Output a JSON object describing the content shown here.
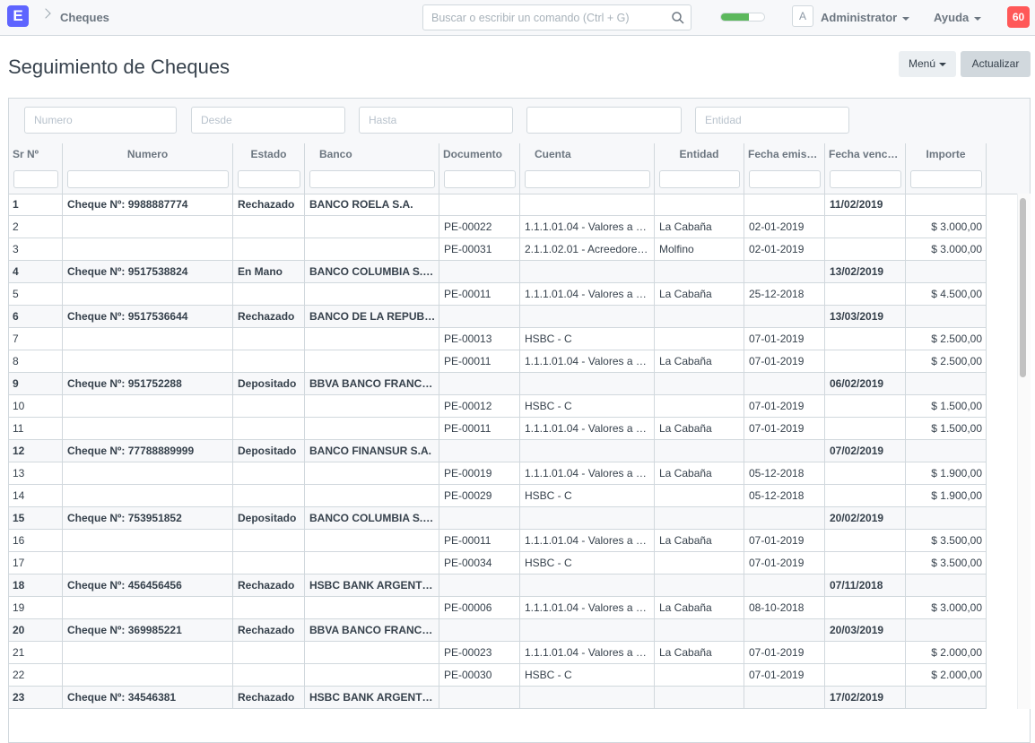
{
  "navbar": {
    "logo": "E",
    "breadcrumb": "Cheques",
    "search_placeholder": "Buscar o escribir un comando (Ctrl + G)",
    "progress_percent": 65,
    "avatar_letter": "A",
    "user_label": "Administrator",
    "help_label": "Ayuda",
    "notifications": "60"
  },
  "page": {
    "title": "Seguimiento de Cheques",
    "menu_label": "Menú",
    "refresh_label": "Actualizar"
  },
  "filters": {
    "numero": "Numero",
    "desde": "Desde",
    "hasta": "Hasta",
    "blank": "",
    "entidad": "Entidad"
  },
  "columns": [
    "Sr Nº",
    "Numero",
    "Estado",
    "Banco",
    "Documento",
    "Cuenta",
    "Entidad",
    "Fecha emis…",
    "Fecha venc…",
    "Importe"
  ],
  "rows": [
    {
      "sr": "1",
      "numero": "Cheque Nº: 9988887774",
      "estado": "Rechazado",
      "banco": "BANCO ROELA S.A.",
      "documento": "",
      "cuenta": "",
      "entidad": "",
      "emision": "",
      "venc": "11/02/2019",
      "importe": "",
      "parent": true
    },
    {
      "sr": "2",
      "numero": "",
      "estado": "",
      "banco": "",
      "documento": "PE-00022",
      "cuenta": "1.1.1.01.04 - Valores a …",
      "entidad": "La Cabaña",
      "emision": "02-01-2019",
      "venc": "",
      "importe": "$ 3.000,00",
      "parent": false
    },
    {
      "sr": "3",
      "numero": "",
      "estado": "",
      "banco": "",
      "documento": "PE-00031",
      "cuenta": "2.1.1.02.01 - Acreedore…",
      "entidad": "Molfino",
      "emision": "02-01-2019",
      "venc": "",
      "importe": "$ 3.000,00",
      "parent": false
    },
    {
      "sr": "4",
      "numero": "Cheque Nº: 9517538824",
      "estado": "En Mano",
      "banco": "BANCO COLUMBIA S.…",
      "documento": "",
      "cuenta": "",
      "entidad": "",
      "emision": "",
      "venc": "13/02/2019",
      "importe": "",
      "parent": true
    },
    {
      "sr": "5",
      "numero": "",
      "estado": "",
      "banco": "",
      "documento": "PE-00011",
      "cuenta": "1.1.1.01.04 - Valores a …",
      "entidad": "La Cabaña",
      "emision": "25-12-2018",
      "venc": "",
      "importe": "$ 4.500,00",
      "parent": false
    },
    {
      "sr": "6",
      "numero": "Cheque Nº: 9517536644",
      "estado": "Rechazado",
      "banco": "BANCO DE LA REPUB…",
      "documento": "",
      "cuenta": "",
      "entidad": "",
      "emision": "",
      "venc": "13/03/2019",
      "importe": "",
      "parent": true
    },
    {
      "sr": "7",
      "numero": "",
      "estado": "",
      "banco": "",
      "documento": "PE-00013",
      "cuenta": "HSBC - C",
      "entidad": "",
      "emision": "07-01-2019",
      "venc": "",
      "importe": "$ 2.500,00",
      "parent": false
    },
    {
      "sr": "8",
      "numero": "",
      "estado": "",
      "banco": "",
      "documento": "PE-00011",
      "cuenta": "1.1.1.01.04 - Valores a …",
      "entidad": "La Cabaña",
      "emision": "07-01-2019",
      "venc": "",
      "importe": "$ 2.500,00",
      "parent": false
    },
    {
      "sr": "9",
      "numero": "Cheque Nº: 951752288",
      "estado": "Depositado",
      "banco": "BBVA BANCO FRANC…",
      "documento": "",
      "cuenta": "",
      "entidad": "",
      "emision": "",
      "venc": "06/02/2019",
      "importe": "",
      "parent": true
    },
    {
      "sr": "10",
      "numero": "",
      "estado": "",
      "banco": "",
      "documento": "PE-00012",
      "cuenta": "HSBC - C",
      "entidad": "",
      "emision": "07-01-2019",
      "venc": "",
      "importe": "$ 1.500,00",
      "parent": false
    },
    {
      "sr": "11",
      "numero": "",
      "estado": "",
      "banco": "",
      "documento": "PE-00011",
      "cuenta": "1.1.1.01.04 - Valores a …",
      "entidad": "La Cabaña",
      "emision": "07-01-2019",
      "venc": "",
      "importe": "$ 1.500,00",
      "parent": false
    },
    {
      "sr": "12",
      "numero": "Cheque Nº: 77788889999",
      "estado": "Depositado",
      "banco": "BANCO FINANSUR S.A.",
      "documento": "",
      "cuenta": "",
      "entidad": "",
      "emision": "",
      "venc": "07/02/2019",
      "importe": "",
      "parent": true
    },
    {
      "sr": "13",
      "numero": "",
      "estado": "",
      "banco": "",
      "documento": "PE-00019",
      "cuenta": "1.1.1.01.04 - Valores a …",
      "entidad": "La Cabaña",
      "emision": "05-12-2018",
      "venc": "",
      "importe": "$ 1.900,00",
      "parent": false
    },
    {
      "sr": "14",
      "numero": "",
      "estado": "",
      "banco": "",
      "documento": "PE-00029",
      "cuenta": "HSBC - C",
      "entidad": "",
      "emision": "05-12-2018",
      "venc": "",
      "importe": "$ 1.900,00",
      "parent": false
    },
    {
      "sr": "15",
      "numero": "Cheque Nº: 753951852",
      "estado": "Depositado",
      "banco": "BANCO COLUMBIA S.…",
      "documento": "",
      "cuenta": "",
      "entidad": "",
      "emision": "",
      "venc": "20/02/2019",
      "importe": "",
      "parent": true
    },
    {
      "sr": "16",
      "numero": "",
      "estado": "",
      "banco": "",
      "documento": "PE-00011",
      "cuenta": "1.1.1.01.04 - Valores a …",
      "entidad": "La Cabaña",
      "emision": "07-01-2019",
      "venc": "",
      "importe": "$ 3.500,00",
      "parent": false
    },
    {
      "sr": "17",
      "numero": "",
      "estado": "",
      "banco": "",
      "documento": "PE-00034",
      "cuenta": "HSBC - C",
      "entidad": "",
      "emision": "07-01-2019",
      "venc": "",
      "importe": "$ 3.500,00",
      "parent": false
    },
    {
      "sr": "18",
      "numero": "Cheque Nº: 456456456",
      "estado": "Rechazado",
      "banco": "HSBC BANK ARGENT…",
      "documento": "",
      "cuenta": "",
      "entidad": "",
      "emision": "",
      "venc": "07/11/2018",
      "importe": "",
      "parent": true
    },
    {
      "sr": "19",
      "numero": "",
      "estado": "",
      "banco": "",
      "documento": "PE-00006",
      "cuenta": "1.1.1.01.04 - Valores a …",
      "entidad": "La Cabaña",
      "emision": "08-10-2018",
      "venc": "",
      "importe": "$ 3.000,00",
      "parent": false
    },
    {
      "sr": "20",
      "numero": "Cheque Nº: 369985221",
      "estado": "Rechazado",
      "banco": "BBVA BANCO FRANC…",
      "documento": "",
      "cuenta": "",
      "entidad": "",
      "emision": "",
      "venc": "20/03/2019",
      "importe": "",
      "parent": true
    },
    {
      "sr": "21",
      "numero": "",
      "estado": "",
      "banco": "",
      "documento": "PE-00023",
      "cuenta": "1.1.1.01.04 - Valores a …",
      "entidad": "La Cabaña",
      "emision": "07-01-2019",
      "venc": "",
      "importe": "$ 2.000,00",
      "parent": false
    },
    {
      "sr": "22",
      "numero": "",
      "estado": "",
      "banco": "",
      "documento": "PE-00030",
      "cuenta": "HSBC - C",
      "entidad": "",
      "emision": "07-01-2019",
      "venc": "",
      "importe": "$ 2.000,00",
      "parent": false
    },
    {
      "sr": "23",
      "numero": "Cheque Nº: 34546381",
      "estado": "Rechazado",
      "banco": "HSBC BANK ARGENT…",
      "documento": "",
      "cuenta": "",
      "entidad": "",
      "emision": "",
      "venc": "17/02/2019",
      "importe": "",
      "parent": true
    }
  ]
}
